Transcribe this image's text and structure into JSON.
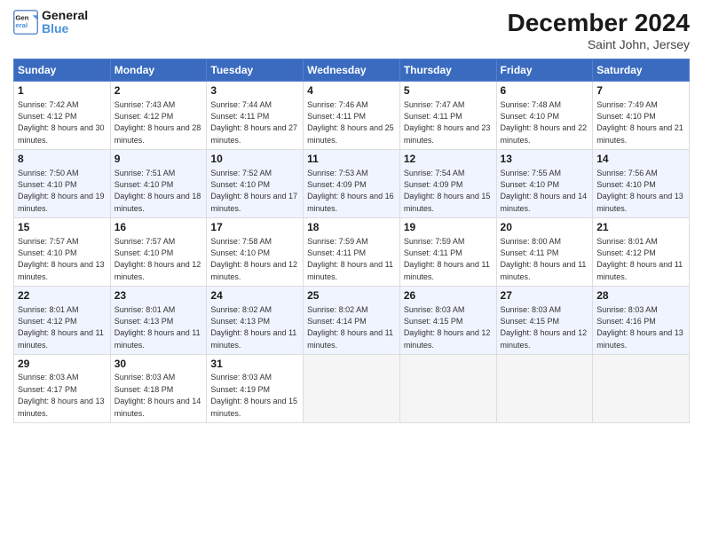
{
  "logo": {
    "line1": "General",
    "line2": "Blue"
  },
  "title": "December 2024",
  "subtitle": "Saint John, Jersey",
  "days_header": [
    "Sunday",
    "Monday",
    "Tuesday",
    "Wednesday",
    "Thursday",
    "Friday",
    "Saturday"
  ],
  "weeks": [
    [
      {
        "day": "1",
        "sunrise": "7:42 AM",
        "sunset": "4:12 PM",
        "daylight": "8 hours and 30 minutes."
      },
      {
        "day": "2",
        "sunrise": "7:43 AM",
        "sunset": "4:12 PM",
        "daylight": "8 hours and 28 minutes."
      },
      {
        "day": "3",
        "sunrise": "7:44 AM",
        "sunset": "4:11 PM",
        "daylight": "8 hours and 27 minutes."
      },
      {
        "day": "4",
        "sunrise": "7:46 AM",
        "sunset": "4:11 PM",
        "daylight": "8 hours and 25 minutes."
      },
      {
        "day": "5",
        "sunrise": "7:47 AM",
        "sunset": "4:11 PM",
        "daylight": "8 hours and 23 minutes."
      },
      {
        "day": "6",
        "sunrise": "7:48 AM",
        "sunset": "4:10 PM",
        "daylight": "8 hours and 22 minutes."
      },
      {
        "day": "7",
        "sunrise": "7:49 AM",
        "sunset": "4:10 PM",
        "daylight": "8 hours and 21 minutes."
      }
    ],
    [
      {
        "day": "8",
        "sunrise": "7:50 AM",
        "sunset": "4:10 PM",
        "daylight": "8 hours and 19 minutes."
      },
      {
        "day": "9",
        "sunrise": "7:51 AM",
        "sunset": "4:10 PM",
        "daylight": "8 hours and 18 minutes."
      },
      {
        "day": "10",
        "sunrise": "7:52 AM",
        "sunset": "4:10 PM",
        "daylight": "8 hours and 17 minutes."
      },
      {
        "day": "11",
        "sunrise": "7:53 AM",
        "sunset": "4:09 PM",
        "daylight": "8 hours and 16 minutes."
      },
      {
        "day": "12",
        "sunrise": "7:54 AM",
        "sunset": "4:09 PM",
        "daylight": "8 hours and 15 minutes."
      },
      {
        "day": "13",
        "sunrise": "7:55 AM",
        "sunset": "4:10 PM",
        "daylight": "8 hours and 14 minutes."
      },
      {
        "day": "14",
        "sunrise": "7:56 AM",
        "sunset": "4:10 PM",
        "daylight": "8 hours and 13 minutes."
      }
    ],
    [
      {
        "day": "15",
        "sunrise": "7:57 AM",
        "sunset": "4:10 PM",
        "daylight": "8 hours and 13 minutes."
      },
      {
        "day": "16",
        "sunrise": "7:57 AM",
        "sunset": "4:10 PM",
        "daylight": "8 hours and 12 minutes."
      },
      {
        "day": "17",
        "sunrise": "7:58 AM",
        "sunset": "4:10 PM",
        "daylight": "8 hours and 12 minutes."
      },
      {
        "day": "18",
        "sunrise": "7:59 AM",
        "sunset": "4:11 PM",
        "daylight": "8 hours and 11 minutes."
      },
      {
        "day": "19",
        "sunrise": "7:59 AM",
        "sunset": "4:11 PM",
        "daylight": "8 hours and 11 minutes."
      },
      {
        "day": "20",
        "sunrise": "8:00 AM",
        "sunset": "4:11 PM",
        "daylight": "8 hours and 11 minutes."
      },
      {
        "day": "21",
        "sunrise": "8:01 AM",
        "sunset": "4:12 PM",
        "daylight": "8 hours and 11 minutes."
      }
    ],
    [
      {
        "day": "22",
        "sunrise": "8:01 AM",
        "sunset": "4:12 PM",
        "daylight": "8 hours and 11 minutes."
      },
      {
        "day": "23",
        "sunrise": "8:01 AM",
        "sunset": "4:13 PM",
        "daylight": "8 hours and 11 minutes."
      },
      {
        "day": "24",
        "sunrise": "8:02 AM",
        "sunset": "4:13 PM",
        "daylight": "8 hours and 11 minutes."
      },
      {
        "day": "25",
        "sunrise": "8:02 AM",
        "sunset": "4:14 PM",
        "daylight": "8 hours and 11 minutes."
      },
      {
        "day": "26",
        "sunrise": "8:03 AM",
        "sunset": "4:15 PM",
        "daylight": "8 hours and 12 minutes."
      },
      {
        "day": "27",
        "sunrise": "8:03 AM",
        "sunset": "4:15 PM",
        "daylight": "8 hours and 12 minutes."
      },
      {
        "day": "28",
        "sunrise": "8:03 AM",
        "sunset": "4:16 PM",
        "daylight": "8 hours and 13 minutes."
      }
    ],
    [
      {
        "day": "29",
        "sunrise": "8:03 AM",
        "sunset": "4:17 PM",
        "daylight": "8 hours and 13 minutes."
      },
      {
        "day": "30",
        "sunrise": "8:03 AM",
        "sunset": "4:18 PM",
        "daylight": "8 hours and 14 minutes."
      },
      {
        "day": "31",
        "sunrise": "8:03 AM",
        "sunset": "4:19 PM",
        "daylight": "8 hours and 15 minutes."
      },
      null,
      null,
      null,
      null
    ]
  ],
  "labels": {
    "sunrise": "Sunrise:",
    "sunset": "Sunset:",
    "daylight": "Daylight:"
  }
}
